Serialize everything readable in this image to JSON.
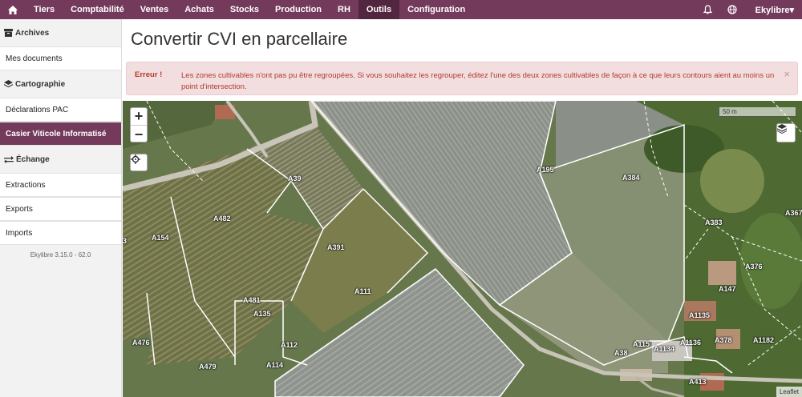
{
  "topbar": {
    "home_icon": "home-icon",
    "nav": [
      "Tiers",
      "Comptabilité",
      "Ventes",
      "Achats",
      "Stocks",
      "Production",
      "RH",
      "Outils",
      "Configuration"
    ],
    "active": "Outils",
    "user": "Ekylibre▾"
  },
  "sidebar": {
    "sections": [
      {
        "title": "Archives",
        "icon": "archive-icon",
        "items": [
          "Mes documents"
        ]
      },
      {
        "title": "Cartographie",
        "icon": "layers-icon",
        "items": [
          "Déclarations PAC",
          "Casier Viticole Informatisé"
        ]
      },
      {
        "title": "Échange",
        "icon": "exchange-icon",
        "items": [
          "Extractions",
          "Exports",
          "Imports"
        ]
      }
    ],
    "active_item": "Casier Viticole Informatisé",
    "version": "Ekylibre 3.15.0 - 62.0"
  },
  "page": {
    "title": "Convertir CVI en parcellaire"
  },
  "alert": {
    "label": "Erreur !",
    "message": "Les zones cultivables n'ont pas pu être regroupées. Si vous souhaitez les regrouper, éditez l'une des deux zones cultivables de façon à ce que leurs contours aient au moins un point d'intersection.",
    "close": "×"
  },
  "map": {
    "scale": "50 m",
    "attribution": "Leaflet",
    "zoom_in": "+",
    "zoom_out": "−",
    "parcels": [
      "3",
      "A154",
      "A482",
      "A39",
      "A391",
      "A111",
      "A481",
      "A135",
      "A112",
      "A114",
      "A479",
      "A476",
      "A195",
      "A384",
      "A383",
      "A367",
      "A376",
      "A147",
      "A1135",
      "A1136",
      "A378",
      "A1182",
      "A115",
      "A1134",
      "A38",
      "A413"
    ]
  }
}
